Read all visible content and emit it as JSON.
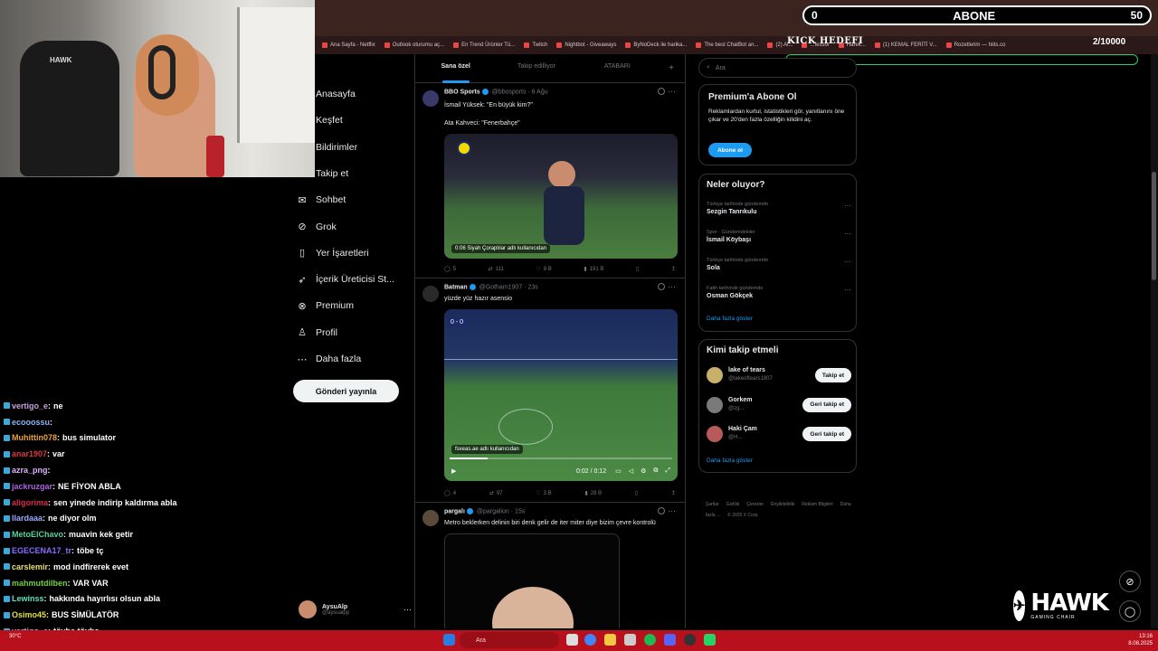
{
  "abone_widget": {
    "left_count": "0",
    "title": "ABONE",
    "right_count": "50"
  },
  "kick_goal": {
    "label": "KICK HEDEFI",
    "count": "2/10000"
  },
  "bookmarks": [
    "Ana Sayfa - Netflix",
    "Outlook oturumu aç...",
    "En Trend Ürünler Tü...",
    "Twitch",
    "Nightbot - Giveaways",
    "ByNoDeck ile harika...",
    "The best ChatBot an...",
    "(2) Al...",
    "...fessor",
    "Harek...",
    "(1) KEMAL FERİTİ V...",
    "Rozetlerim — hiits.co"
  ],
  "webcam": {
    "chair_logo": "HAWK"
  },
  "chat": [
    {
      "user": "vertigo_e",
      "msg": "ne",
      "color": "#c9a0dc"
    },
    {
      "user": "ecooossu",
      "msg": "",
      "color": "#8ab4f8"
    },
    {
      "user": "Muhittin078",
      "msg": "bus simulator",
      "color": "#e8a33d"
    },
    {
      "user": "anar1907",
      "msg": "var",
      "color": "#d83a3a"
    },
    {
      "user": "azra_png",
      "msg": "",
      "color": "#e0b0ff"
    },
    {
      "user": "jackruzgar",
      "msg": "NE FİYON ABLA",
      "color": "#b060e0"
    },
    {
      "user": "aligorima",
      "msg": "sen yinede indirip kaldırma abla",
      "color": "#d82a4a"
    },
    {
      "user": "llardaaa",
      "msg": "ne diyor olm",
      "color": "#9aa8ff"
    },
    {
      "user": "MetoElChavo",
      "msg": "muavin kek getir",
      "color": "#5ad0a0"
    },
    {
      "user": "EGECENA17_tr",
      "msg": "töbe tç",
      "color": "#8a6cff"
    },
    {
      "user": "carslemir",
      "msg": "mod indfirerek evet",
      "color": "#e8e070"
    },
    {
      "user": "mahmutdilben",
      "msg": "VAR VAR",
      "color": "#70d040"
    },
    {
      "user": "Lewinss",
      "msg": "hakkında hayırlısı olsun abla",
      "color": "#60e0c0"
    },
    {
      "user": "Osimo45",
      "msg": "BUS SİMÜLATÖR",
      "color": "#e0e040"
    },
    {
      "user": "vertigo_e",
      "msg": "tövbe tövbe",
      "color": "#c9a0dc"
    }
  ],
  "sidebar": {
    "items": [
      {
        "label": "Anasayfa",
        "icon": "home-icon"
      },
      {
        "label": "Keşfet",
        "icon": "search-icon"
      },
      {
        "label": "Bildirimler",
        "icon": "bell-icon"
      },
      {
        "label": "Takip et",
        "icon": "follow-icon"
      },
      {
        "label": "Sohbet",
        "icon": "chat-icon"
      },
      {
        "label": "Grok",
        "icon": "grok-icon"
      },
      {
        "label": "Yer İşaretleri",
        "icon": "bookmark-icon"
      },
      {
        "label": "İçerik Üreticisi St...",
        "icon": "rocket-icon"
      },
      {
        "label": "Premium",
        "icon": "premium-icon"
      },
      {
        "label": "Profil",
        "icon": "profile-icon"
      },
      {
        "label": "Daha fazla",
        "icon": "more-icon"
      }
    ],
    "post_button": "Gönderi yayınla",
    "profile": {
      "name": "AysuAlp",
      "handle": "@aysualpp"
    }
  },
  "feed": {
    "tabs": [
      "Sana özel",
      "Takip edilliyor",
      "ATABARI"
    ],
    "tweets": [
      {
        "name": "BBO Sports",
        "handle": "@bbosports",
        "time": "6 Ağu",
        "text1": "İsmail Yüksek: \"En büyük kim?\"",
        "text2": "Ata Kahveci: \"Fenerbahçe\"",
        "media_badge": "0:06  Siyah Çoraplılar adlı kullanıcıdan",
        "replies": "5",
        "reposts": "111",
        "likes": "8 B",
        "views": "191 B"
      },
      {
        "name": "Batman",
        "handle": "@Gotham1907",
        "time": "23s",
        "text1": "yüzde yüz hazır asensio",
        "media_badge": "fsxeas.ae adlı kullanıcıdan",
        "video_time": "0:02 / 0:12",
        "progress": 0.17,
        "replies": "4",
        "reposts": "97",
        "likes": "3 B",
        "views": "28 B"
      },
      {
        "name": "pargalı",
        "handle": "@pargalion",
        "time": "15s",
        "text1": "Metro beklerken delinin biri denk gelir de iter miter diye bizim çevre kontrolü"
      }
    ]
  },
  "right": {
    "search_placeholder": "Ara",
    "premium": {
      "title": "Premium'a Abone Ol",
      "text": "Reklamlardan kurtul, istatistikleri gör, yanıtlanını öne çıkar ve 20'den fazla özelliğin kilidini aç.",
      "button": "Abone ol"
    },
    "trends_title": "Neler oluyor?",
    "trends": [
      {
        "category": "Türkiye tarihinde gündemde",
        "name": "Sezgin Tanrıkulu"
      },
      {
        "category": "Spor · Gündemdekiler",
        "name": "İsmail Köybaşı"
      },
      {
        "category": "Türkiye tarihinde gündemde",
        "name": "Sola"
      },
      {
        "category": "Fatih tarihinde gündemde",
        "name": "Osman Gökçek"
      }
    ],
    "show_more": "Daha fazla göster",
    "who_title": "Kimi takip etmeli",
    "who": [
      {
        "name": "lake of tears",
        "handle": "@lakeoftears1907",
        "button": "Takip et"
      },
      {
        "name": "Gorkem",
        "handle": "@zg...",
        "button": "Geri takip et"
      },
      {
        "name": "Haki Çam",
        "handle": "@H...",
        "button": "Geri takip et"
      }
    ],
    "footer": [
      "Şartlar",
      "Gizlilik",
      "Çerezler",
      "Erişilebilirlik",
      "Reklam Bilgileri",
      "Daha fazla ...",
      "© 2025 X Corp."
    ]
  },
  "hawk": {
    "brand": "HAWK",
    "sub": "GAMING CHAIR"
  },
  "taskbar": {
    "search": "Ara",
    "weather": "30°C",
    "time": "13:16",
    "date": "8.08.2025"
  }
}
